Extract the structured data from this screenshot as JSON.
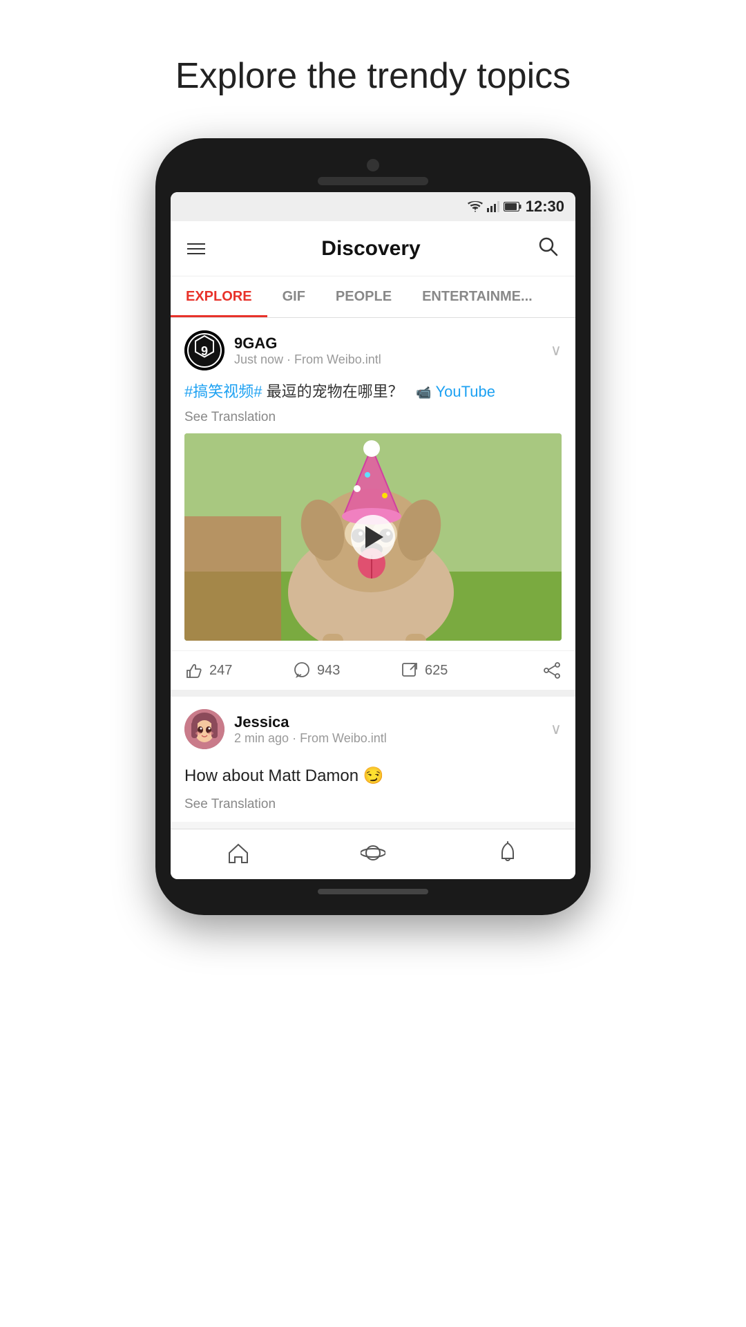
{
  "page": {
    "title": "Explore the trendy topics"
  },
  "status_bar": {
    "time": "12:30"
  },
  "app_bar": {
    "title": "Discovery",
    "search_label": "search"
  },
  "tabs": [
    {
      "id": "explore",
      "label": "EXPLORE",
      "active": true
    },
    {
      "id": "gif",
      "label": "GIF",
      "active": false
    },
    {
      "id": "people",
      "label": "PEOPLE",
      "active": false
    },
    {
      "id": "entertainment",
      "label": "ENTERTAINME...",
      "active": false
    }
  ],
  "posts": [
    {
      "id": "post1",
      "username": "9GAG",
      "time": "Just now",
      "source": "From Weibo.intl",
      "hashtag": "#搞笑视频#",
      "text_cn": " 最逗的宠物在哪里？",
      "yt_link": "YouTube",
      "see_translation": "See Translation",
      "likes": "247",
      "comments": "943",
      "shares": "625"
    },
    {
      "id": "post2",
      "username": "Jessica",
      "time": "2 min ago",
      "source": "From Weibo.intl",
      "text": "How about Matt Damon 😏",
      "see_translation": "See Translation"
    }
  ],
  "bottom_nav": [
    {
      "id": "home",
      "icon": "home"
    },
    {
      "id": "explore",
      "icon": "planet"
    },
    {
      "id": "notifications",
      "icon": "bell"
    }
  ],
  "icons": {
    "wifi": "▼",
    "signal": "▲",
    "battery": "🔋",
    "search": "🔍",
    "chevron_down": "⌄",
    "play": "▶",
    "like": "👍",
    "comment": "💬",
    "repost": "↗",
    "share": "⋯",
    "home": "⌂",
    "planet": "🪐",
    "bell": "🔔"
  }
}
